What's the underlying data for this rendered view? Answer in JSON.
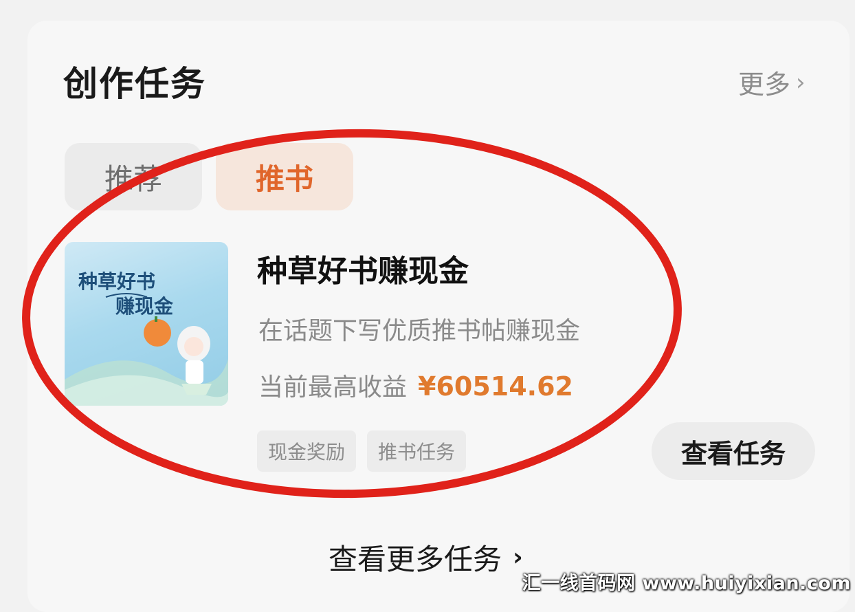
{
  "section": {
    "title": "创作任务",
    "more_label": "更多",
    "more_icon": "chevron-right-icon"
  },
  "tabs": [
    {
      "label": "推荐",
      "active": false
    },
    {
      "label": "推书",
      "active": true
    }
  ],
  "task": {
    "thumbnail_text_line1": "种草好书",
    "thumbnail_text_line2": "赚现金",
    "title": "种草好书赚现金",
    "description": "在话题下写优质推书帖赚现金",
    "earnings_label": "当前最高收益",
    "earnings_value": "¥60514.62",
    "tags": [
      "现金奖励",
      "推书任务"
    ],
    "action_label": "查看任务"
  },
  "footer": {
    "view_more_label": "查看更多任务",
    "view_more_icon": "chevron-right-icon"
  },
  "watermark": "汇一线首码网 www.huiyixian.com",
  "colors": {
    "accent": "#e0662b",
    "earnings": "#e07a2e",
    "annotation": "#e0221a"
  }
}
